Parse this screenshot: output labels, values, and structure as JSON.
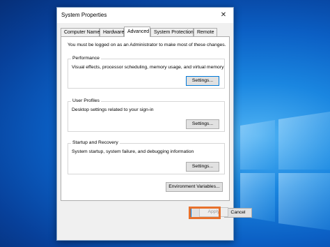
{
  "dialog": {
    "title": "System Properties",
    "close_label": "✕",
    "tabs": [
      {
        "label": "Computer Name"
      },
      {
        "label": "Hardware"
      },
      {
        "label": "Advanced",
        "active": true
      },
      {
        "label": "System Protection"
      },
      {
        "label": "Remote"
      }
    ],
    "admin_note": "You must be logged on as an Administrator to make most of these changes.",
    "performance": {
      "label": "Performance",
      "description": "Visual effects, processor scheduling, memory usage, and virtual memory",
      "button": "Settings..."
    },
    "user_profiles": {
      "label": "User Profiles",
      "description": "Desktop settings related to your sign-in",
      "button": "Settings..."
    },
    "startup_recovery": {
      "label": "Startup and Recovery",
      "description": "System startup, system failure, and debugging information",
      "button": "Settings..."
    },
    "env_button": "Environment Variables...",
    "footer": {
      "ok": "OK",
      "cancel": "Cancel",
      "apply": "Apply"
    }
  },
  "colors": {
    "highlight": "#e8712c",
    "desktop": "#0b5fc4",
    "focus": "#0078d7"
  }
}
